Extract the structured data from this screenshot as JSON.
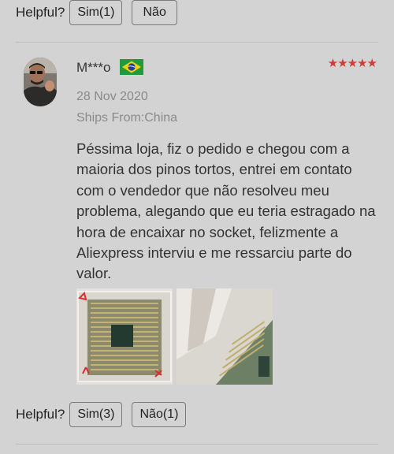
{
  "top_helpful": {
    "label": "Helpful?",
    "yes": "Sim(1)",
    "no": "Não"
  },
  "review": {
    "username": "M***o",
    "country_flag": "brazil-flag-icon",
    "stars": "★★★★★",
    "rating": 5,
    "date": "28 Nov 2020",
    "ships_from": "Ships From:China",
    "text": "Péssima loja, fiz o pedido e chegou com a maioria dos pinos tortos, entrei em contato com o vendedor que não resolveu meu problema, alegando que eu teria estragado na hora de encaixar no socket, felizmente a Aliexpress interviu e me ressarciu parte do valor.",
    "photos": [
      "cpu-back-photo",
      "cpu-pins-closeup-photo"
    ]
  },
  "bottom_helpful": {
    "label": "Helpful?",
    "yes": "Sim(3)",
    "no": "Não(1)"
  },
  "colors": {
    "background": "#d3d3d3",
    "star": "#d23b36",
    "meta_text": "#8a8a8a"
  }
}
